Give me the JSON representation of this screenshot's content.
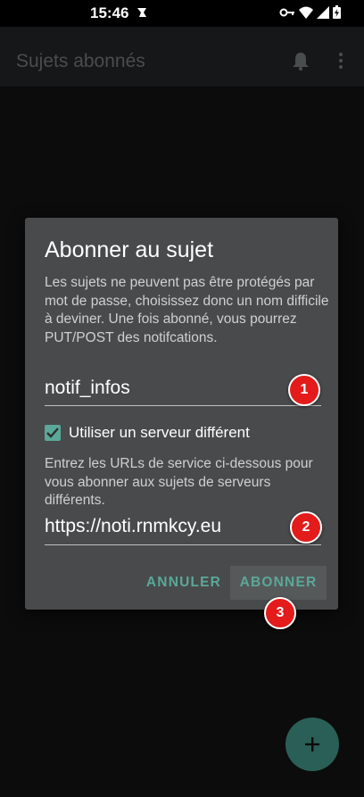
{
  "status_bar": {
    "time": "15:46"
  },
  "app_bar": {
    "title": "Sujets abonnés"
  },
  "dialog": {
    "title": "Abonner au sujet",
    "description": "Les sujets ne peuvent pas être protégés par mot de passe, choisissez donc un nom difficile à deviner. Une fois abonné, vous pourrez PUT/POST des notifcations.",
    "topic_value": "notif_infos",
    "checkbox_label": "Utiliser un serveur différent",
    "checkbox_checked": true,
    "server_description": "Entrez les URLs de service ci-dessous pour vous abonner aux sujets de serveurs différents.",
    "server_value": "https://noti.rnmkcy.eu",
    "cancel_label": "ANNULER",
    "subscribe_label": "ABONNER"
  },
  "badges": [
    "1",
    "2",
    "3"
  ],
  "fab": {
    "icon": "plus-icon"
  },
  "colors": {
    "accent": "#5aa899",
    "dialog_bg": "#494a4b",
    "badge": "#e31b1b"
  }
}
